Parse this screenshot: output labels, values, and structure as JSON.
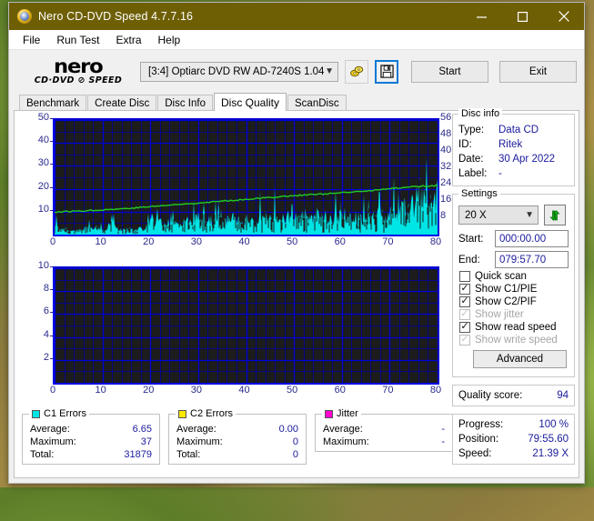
{
  "window": {
    "title": "Nero CD-DVD Speed 4.7.7.16",
    "icon": "nero-app-icon",
    "controls": {
      "minimize": "minimize-icon",
      "maximize": "maximize-icon",
      "close": "close-icon"
    },
    "titlebar_color": "#6e5f05"
  },
  "menu": {
    "items": [
      "File",
      "Run Test",
      "Extra",
      "Help"
    ]
  },
  "toolbar": {
    "logo_line1": "nero",
    "logo_line2": "CD·DVD ⊘ SPEED",
    "drive": "[3:4]   Optiarc DVD RW AD-7240S 1.04",
    "drive_chevron": "chevron-down-icon",
    "eject_icon": "eject-disc-icon",
    "save_icon": "save-floppy-icon",
    "start_label": "Start",
    "exit_label": "Exit"
  },
  "tabs": {
    "items": [
      "Benchmark",
      "Create Disc",
      "Disc Info",
      "Disc Quality",
      "ScanDisc"
    ],
    "active": "Disc Quality"
  },
  "disc_info": {
    "title": "Disc info",
    "rows": [
      {
        "key": "Type:",
        "value": "Data CD"
      },
      {
        "key": "ID:",
        "value": "Ritek"
      },
      {
        "key": "Date:",
        "value": "30 Apr 2022"
      },
      {
        "key": "Label:",
        "value": "-"
      }
    ]
  },
  "settings": {
    "title": "Settings",
    "speed": "20 X",
    "speed_chevron": "chevron-down-icon",
    "refresh_icon": "refresh-icon",
    "start_label": "Start:",
    "start_value": "000:00.00",
    "end_label": "End:",
    "end_value": "079:57.70",
    "checkboxes": [
      {
        "label": "Quick scan",
        "checked": false,
        "enabled": true
      },
      {
        "label": "Show C1/PIE",
        "checked": true,
        "enabled": true
      },
      {
        "label": "Show C2/PIF",
        "checked": true,
        "enabled": true
      },
      {
        "label": "Show jitter",
        "checked": true,
        "enabled": false
      },
      {
        "label": "Show read speed",
        "checked": true,
        "enabled": true
      },
      {
        "label": "Show write speed",
        "checked": true,
        "enabled": false
      }
    ],
    "advanced_label": "Advanced"
  },
  "quality": {
    "label": "Quality score:",
    "value": "94"
  },
  "status": {
    "rows": [
      {
        "key": "Progress:",
        "value": "100 %"
      },
      {
        "key": "Position:",
        "value": "79:55.60"
      },
      {
        "key": "Speed:",
        "value": "21.39 X"
      }
    ]
  },
  "legends": [
    {
      "title": "C1 Errors",
      "color": "#00e5e5",
      "rows": [
        {
          "key": "Average:",
          "value": "6.65"
        },
        {
          "key": "Maximum:",
          "value": "37"
        },
        {
          "key": "Total:",
          "value": "31879"
        }
      ]
    },
    {
      "title": "C2 Errors",
      "color": "#ffe800",
      "rows": [
        {
          "key": "Average:",
          "value": "0.00"
        },
        {
          "key": "Maximum:",
          "value": "0"
        },
        {
          "key": "Total:",
          "value": "0"
        }
      ]
    },
    {
      "title": "Jitter",
      "color": "#ff00d0",
      "rows": [
        {
          "key": "Average:",
          "value": "-"
        },
        {
          "key": "Maximum:",
          "value": "-"
        }
      ]
    }
  ],
  "chart_data": [
    {
      "type": "area",
      "name": "c1-error-graph",
      "title": "",
      "xlabel": "",
      "ylabel": "C1 errors",
      "xlim": [
        0,
        80
      ],
      "ylim": [
        0,
        50
      ],
      "y2lim": [
        0,
        56
      ],
      "y2label": "Read speed (X)",
      "xticks": [
        0,
        10,
        20,
        30,
        40,
        50,
        60,
        70,
        80
      ],
      "yticks": [
        10,
        20,
        30,
        40,
        50
      ],
      "y2ticks": [
        8,
        16,
        24,
        32,
        40,
        48,
        56
      ],
      "grid": true,
      "background": "#1c1c1c",
      "grid_color": "#0000d8",
      "series": [
        {
          "name": "C1 errors",
          "color": "#00e5e5",
          "style": "filled-spikes",
          "x": [
            0,
            1,
            2,
            3,
            4,
            5,
            6,
            7,
            8,
            9,
            10,
            11,
            12,
            13,
            14,
            15,
            16,
            17,
            18,
            19,
            20,
            21,
            22,
            23,
            24,
            25,
            26,
            27,
            28,
            29,
            30,
            31,
            32,
            33,
            34,
            35,
            36,
            37,
            38,
            39,
            40,
            41,
            42,
            43,
            44,
            45,
            46,
            47,
            48,
            49,
            50,
            51,
            52,
            53,
            54,
            55,
            56,
            57,
            58,
            59,
            60,
            61,
            62,
            63,
            64,
            65,
            66,
            67,
            68,
            69,
            70,
            71,
            72,
            73,
            74,
            75,
            76,
            77,
            78,
            79,
            80
          ],
          "values": [
            7,
            4,
            3,
            3,
            4,
            3,
            4,
            6,
            3,
            4,
            3,
            5,
            7,
            4,
            3,
            4,
            3,
            3,
            4,
            3,
            11,
            9,
            10,
            8,
            11,
            12,
            9,
            8,
            11,
            9,
            13,
            12,
            10,
            9,
            11,
            9,
            10,
            12,
            9,
            10,
            13,
            9,
            8,
            11,
            14,
            10,
            12,
            11,
            10,
            13,
            11,
            14,
            16,
            12,
            13,
            18,
            13,
            11,
            13,
            12,
            14,
            12,
            13,
            11,
            10,
            14,
            13,
            15,
            16,
            13,
            14,
            17,
            15,
            18,
            20,
            19,
            30,
            24,
            21,
            24,
            26
          ]
        },
        {
          "name": "Read speed",
          "color": "#22cc22",
          "style": "line",
          "x": [
            0,
            5,
            10,
            15,
            20,
            25,
            30,
            35,
            40,
            45,
            50,
            55,
            60,
            65,
            70,
            75,
            80
          ],
          "values": [
            9.8,
            10.3,
            10.8,
            11.4,
            12.2,
            13.0,
            13.8,
            14.6,
            15.4,
            16.2,
            17.0,
            17.6,
            18.2,
            19.0,
            20.0,
            21.0,
            21.4
          ]
        }
      ]
    },
    {
      "type": "area",
      "name": "c2-error-graph",
      "title": "",
      "xlabel": "",
      "ylabel": "C2 errors",
      "xlim": [
        0,
        80
      ],
      "ylim": [
        0,
        10
      ],
      "xticks": [
        0,
        10,
        20,
        30,
        40,
        50,
        60,
        70,
        80
      ],
      "yticks": [
        2,
        4,
        6,
        8,
        10
      ],
      "grid": true,
      "background": "#1c1c1c",
      "grid_color": "#0000d8",
      "series": [
        {
          "name": "C2 errors",
          "color": "#ffe800",
          "style": "filled-spikes",
          "x": [
            0,
            80
          ],
          "values": [
            0,
            0
          ]
        }
      ]
    }
  ]
}
